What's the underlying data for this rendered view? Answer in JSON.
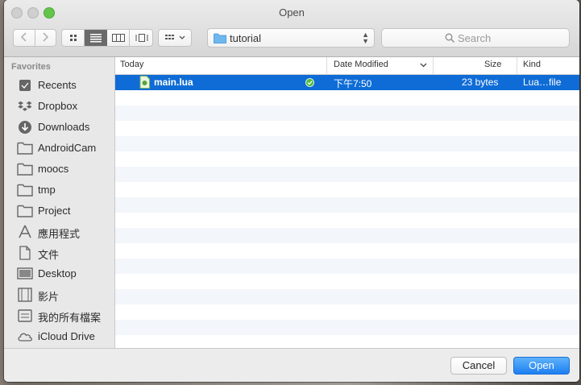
{
  "window": {
    "title": "Open"
  },
  "toolbar": {
    "location": "tutorial",
    "search_placeholder": "Search"
  },
  "sidebar": {
    "section": "Favorites",
    "items": [
      {
        "label": "Recents",
        "icon": "recents-icon"
      },
      {
        "label": "Dropbox",
        "icon": "dropbox-icon"
      },
      {
        "label": "Downloads",
        "icon": "downloads-icon"
      },
      {
        "label": "AndroidCam",
        "icon": "folder-icon"
      },
      {
        "label": "moocs",
        "icon": "folder-icon"
      },
      {
        "label": "tmp",
        "icon": "folder-icon"
      },
      {
        "label": "Project",
        "icon": "folder-icon"
      },
      {
        "label": "應用程式",
        "icon": "applications-icon"
      },
      {
        "label": "文件",
        "icon": "documents-icon"
      },
      {
        "label": "Desktop",
        "icon": "desktop-icon"
      },
      {
        "label": "影片",
        "icon": "movies-icon"
      },
      {
        "label": "我的所有檔案",
        "icon": "all-files-icon"
      },
      {
        "label": "iCloud Drive",
        "icon": "icloud-icon"
      }
    ]
  },
  "columns": {
    "name": "Today",
    "modified": "Date Modified",
    "size": "Size",
    "kind": "Kind"
  },
  "files": [
    {
      "name": "main.lua",
      "modified": "下午7:50",
      "size": "23 bytes",
      "kind": "Lua…file",
      "selected": true
    }
  ],
  "footer": {
    "cancel": "Cancel",
    "open": "Open"
  },
  "colors": {
    "selection": "#0f6cd6",
    "primary_button": "#1d7ff0",
    "zoom_light": "#63c64a"
  }
}
